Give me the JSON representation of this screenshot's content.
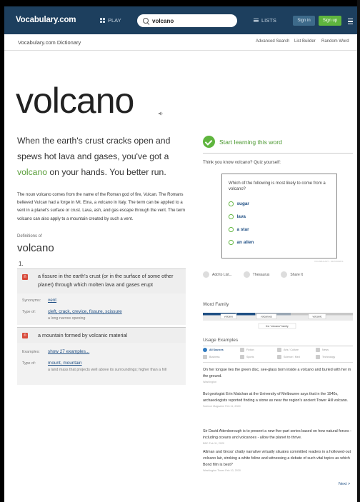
{
  "nav": {
    "logo": "Vocabulary.com",
    "play": "PLAY",
    "search_value": "volcano",
    "lists": "LISTS",
    "sign_in": "Sign in",
    "sign_up": "Sign up"
  },
  "subnav": {
    "title": "Vocabulary.com Dictionary",
    "links": [
      "Advanced Search",
      "List Builder",
      "Random Word"
    ]
  },
  "entry": {
    "word": "volcano",
    "short_before": "When the earth's crust cracks open and spews hot lava and gases, you've got a ",
    "short_highlight": "volcano",
    "short_after": " on your hands. You better run.",
    "long": "The noun volcano comes from the name of the Roman god of fire, Vulcan. The Romans believed Vulcan had a forge in Mt. Etna, a volcano in Italy. The term can be applied to a vent in a planet's surface or crust. Lava, ash, and gas escape through the vent. The term volcano can also apply to a mountain created by such a vent.",
    "definitions_label": "Definitions of",
    "definitions_word": "volcano",
    "group_number": "1."
  },
  "senses": [
    {
      "badge": "n",
      "gloss": "a fissure in the earth's crust (or in the surface of some other planet) through which molten lava and gases erupt",
      "synonyms_label": "Synonyms:",
      "synonyms": "vent",
      "type_label": "Type of:",
      "type_of": "cleft, crack, crevice, fissure, scissure",
      "type_desc": "a long narrow opening"
    },
    {
      "badge": "n",
      "gloss": "a mountain formed by volcanic material",
      "examples_label": "Examples:",
      "examples": "show 27 examples...",
      "type_label": "Type of:",
      "type_of": "mount, mountain",
      "type_desc": "a land mass that projects well above its surroundings; higher than a hill"
    }
  ],
  "learn": {
    "start": "Start learning this word",
    "think": "Think you know volcano? Quiz yourself:",
    "question": "Which of the following is most likely to come from a volcano?",
    "options": [
      "sugar",
      "lava",
      "a star",
      "an alien"
    ],
    "tiny_note": "VOCABULARY - NETWORKS"
  },
  "actions": [
    "Add to List...",
    "Thesaurus",
    "Share It"
  ],
  "word_family": {
    "title": "Word Family",
    "words": [
      "volcano",
      "volcanoes",
      "volcanic"
    ],
    "family_label": "the \"volcano\" family"
  },
  "usage": {
    "title": "Usage Examples",
    "tabs": [
      "All Sources",
      "Fiction",
      "Arts / Culture",
      "News",
      "Business",
      "Sports",
      "Science / Med",
      "Technology"
    ],
    "examples": [
      {
        "text": "On her tongue lies the green disc, see-glass born inside a volcano and buried with her in the ground.",
        "source": "Washington"
      },
      {
        "text": "But geologist Erin Matchan at the University of Melbourne says that in the 1940s, archaeologists reported finding a stone ax near the region's ancient Tower Hill volcano.",
        "source": "Science Magazine   Feb 11, 2020"
      },
      {
        "text": "Sir David Attenborough is to present a new five-part series based on how natural forces - including oceans and volcanoes - allow the planet to thrive.",
        "source": "BBC   Feb 11, 2020"
      },
      {
        "text": "Altman and Gross' chatty narrative virtually situates committed readers in a hollowed-out volcano lair, stroking a white feline and witnessing a debate of such vital topics as which Bond film is best?",
        "source": "Washington Times   Feb 10, 2020"
      }
    ],
    "next": "Next >"
  }
}
